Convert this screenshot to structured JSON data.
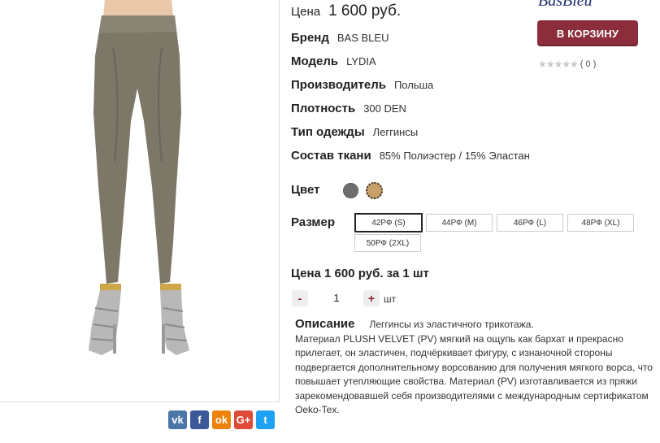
{
  "brand_logo": "BasBleu",
  "price": {
    "label": "Цена",
    "value": "1 600 руб."
  },
  "attributes": [
    {
      "label": "Бренд",
      "value": "BAS BLEU"
    },
    {
      "label": "Модель",
      "value": "LYDIA"
    },
    {
      "label": "Производитель",
      "value": "Польша"
    },
    {
      "label": "Плотность",
      "value": "300 DEN"
    },
    {
      "label": "Тип одежды",
      "value": "Леггинсы"
    },
    {
      "label": "Состав ткани",
      "value": "85% Полиэстер / 15% Эластан"
    }
  ],
  "cart_button": "В КОРЗИНУ",
  "rating": {
    "count": "( 0 )",
    "stars": 0,
    "max": 5
  },
  "color": {
    "label": "Цвет",
    "swatches": [
      "#6e6e6e",
      "#c8a06a"
    ]
  },
  "size": {
    "label": "Размер",
    "options": [
      "42РФ (S)",
      "44РФ (M)",
      "46РФ (L)",
      "48РФ (XL)",
      "50РФ (2XL)"
    ],
    "selected": "42РФ (S)"
  },
  "unit_price": "Цена 1 600 руб. за 1 шт",
  "quantity": {
    "minus": "-",
    "value": "1",
    "plus": "+",
    "unit": "шт"
  },
  "description": {
    "title": "Описание",
    "lead": "Леггинсы из эластичного трикотажа.",
    "body": "Материал PLUSH VELVET (PV) мягкий на ощупь как бархат и прекрасно прилегает, он эластичен, подчёркивает фигуру, с изнаночной стороны подвергается дополнительному ворсованию для получения мягкого ворса, что повышает утепляющие свойства. Материал (PV) изготавливается из пряжи зарекомендовавшей себя производителями с международным сертификатом Oeko-Tex."
  },
  "social": [
    {
      "name": "vk-icon",
      "glyph": "vk",
      "color": "#4a76a8"
    },
    {
      "name": "facebook-icon",
      "glyph": "f",
      "color": "#3b5998"
    },
    {
      "name": "odnoklassniki-icon",
      "glyph": "ok",
      "color": "#ee8208"
    },
    {
      "name": "google-plus-icon",
      "glyph": "G+",
      "color": "#dd4b39"
    },
    {
      "name": "twitter-icon",
      "glyph": "t",
      "color": "#1da1f2"
    }
  ]
}
